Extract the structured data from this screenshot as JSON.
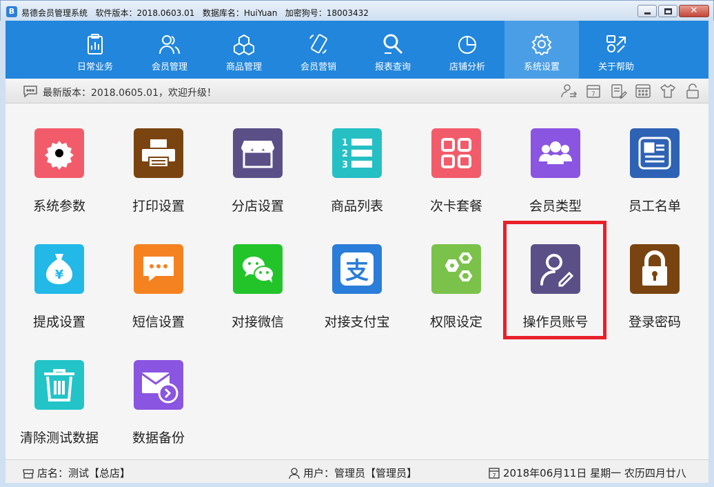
{
  "window": {
    "title": "易德会员管理系统   软件版本：2018.0603.01   数据库名：HuiYuan   加密狗号：18003432",
    "app_icon_glyph": "B"
  },
  "nav": {
    "items": [
      {
        "label": "日常业务",
        "icon": "clipboard-chart-icon"
      },
      {
        "label": "会员管理",
        "icon": "users-icon"
      },
      {
        "label": "商品管理",
        "icon": "boxes-icon"
      },
      {
        "label": "会员营销",
        "icon": "phone-icon"
      },
      {
        "label": "报表查询",
        "icon": "magnifier-icon"
      },
      {
        "label": "店铺分析",
        "icon": "pie-chart-icon"
      },
      {
        "label": "系统设置",
        "icon": "gear-icon"
      },
      {
        "label": "关于帮助",
        "icon": "help-icon"
      }
    ],
    "active_index": 6
  },
  "notice": {
    "message": "最新版本：2018.0605.01，欢迎升级！"
  },
  "tiles": [
    {
      "label": "系统参数",
      "color": "#f25c6a",
      "icon": "gear-icon"
    },
    {
      "label": "打印设置",
      "color": "#7a4410",
      "icon": "printer-icon"
    },
    {
      "label": "分店设置",
      "color": "#5a5087",
      "icon": "store-icon"
    },
    {
      "label": "商品列表",
      "color": "#26bfc4",
      "icon": "numbered-list-icon"
    },
    {
      "label": "次卡套餐",
      "color": "#f25c6a",
      "icon": "grid-icon"
    },
    {
      "label": "会员类型",
      "color": "#8a55e0",
      "icon": "group-icon"
    },
    {
      "label": "员工名单",
      "color": "#2e62b4",
      "icon": "id-card-icon"
    },
    {
      "label": "提成设置",
      "color": "#22b8e8",
      "icon": "money-bag-icon"
    },
    {
      "label": "短信设置",
      "color": "#f58220",
      "icon": "chat-icon"
    },
    {
      "label": "对接微信",
      "color": "#22c42a",
      "icon": "wechat-icon"
    },
    {
      "label": "对接支付宝",
      "color": "#2a7dd8",
      "icon": "alipay-icon"
    },
    {
      "label": "权限设定",
      "color": "#7bc24a",
      "icon": "hexagons-icon"
    },
    {
      "label": "操作员账号",
      "color": "#5a5087",
      "icon": "user-edit-icon"
    },
    {
      "label": "登录密码",
      "color": "#7a4410",
      "icon": "lock-icon"
    },
    {
      "label": "清除测试数据",
      "color": "#22c4c8",
      "icon": "trash-icon"
    },
    {
      "label": "数据备份",
      "color": "#8a55e0",
      "icon": "mail-forward-icon"
    }
  ],
  "alipay_glyph": "支",
  "money_glyph": "¥",
  "list_glyphs": [
    "1",
    "2",
    "3"
  ],
  "status": {
    "store": "店名：测试【总店】",
    "user": "用户：管理员【管理员】",
    "date": "2018年06月11日 星期一 农历四月廿八",
    "calendar_day": "7"
  }
}
